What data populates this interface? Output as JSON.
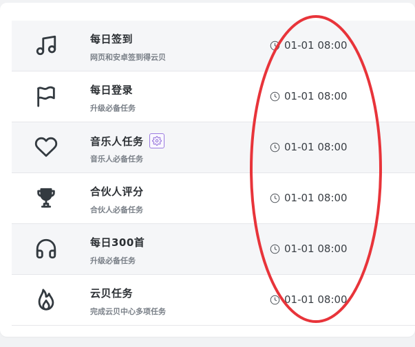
{
  "tasks": [
    {
      "icon": "music-note-icon",
      "title": "每日签到",
      "subtitle": "网页和安卓签到得云贝",
      "time": "01-01 08:00"
    },
    {
      "icon": "flag-icon",
      "title": "每日登录",
      "subtitle": "升级必备任务",
      "time": "01-01 08:00"
    },
    {
      "icon": "heart-icon",
      "title": "音乐人任务",
      "subtitle": "音乐人必备任务",
      "time": "01-01 08:00",
      "badge_icon": "gear-icon"
    },
    {
      "icon": "trophy-icon",
      "title": "合伙人评分",
      "subtitle": "合伙人必备任务",
      "time": "01-01 08:00"
    },
    {
      "icon": "headphones-icon",
      "title": "每日300首",
      "subtitle": "升级必备任务",
      "time": "01-01 08:00"
    },
    {
      "icon": "fire-icon",
      "title": "云贝任务",
      "subtitle": "完成云贝中心多项任务",
      "time": "01-01 08:00"
    }
  ],
  "annotation": {
    "color": "#e8343a",
    "shape": "ellipse"
  }
}
